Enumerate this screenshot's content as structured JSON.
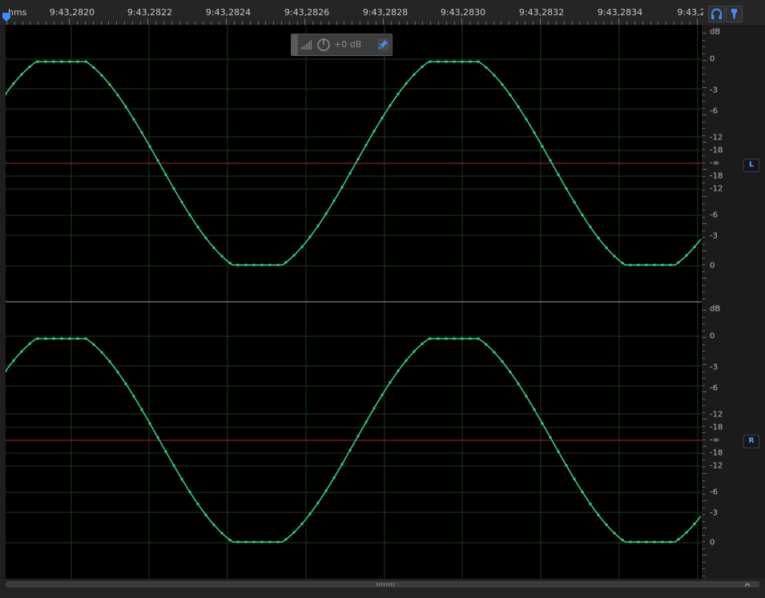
{
  "ruler": {
    "unit_label": "hms",
    "time_labels": [
      "9:43,2820",
      "9:43,2822",
      "9:43,2824",
      "9:43,2826",
      "9:43,2828",
      "9:43,2830",
      "9:43,2832",
      "9:43,2834",
      "9:43,2"
    ]
  },
  "hud": {
    "gain_label": "+0 dB"
  },
  "channels": [
    {
      "badge": "L",
      "scale_labels": [
        "dB",
        "0",
        "-3",
        "-6",
        "-12",
        "-18",
        "-∞",
        "-18",
        "-12",
        "-6",
        "-3",
        "0"
      ]
    },
    {
      "badge": "R",
      "scale_labels": [
        "dB",
        "0",
        "-3",
        "-6",
        "-12",
        "-18",
        "-∞",
        "-18",
        "-12",
        "-6",
        "-3",
        "0"
      ]
    }
  ],
  "colors": {
    "waveform": "#33cc88",
    "center_line": "#b3232e",
    "grid": "#1d3a1d",
    "accent": "#3d8fff"
  },
  "icons": {
    "playhead": "playhead-marker-icon",
    "headphones": "headphones-icon",
    "pin": "pin-icon",
    "power": "power-icon",
    "meter": "level-meter-icon"
  }
}
